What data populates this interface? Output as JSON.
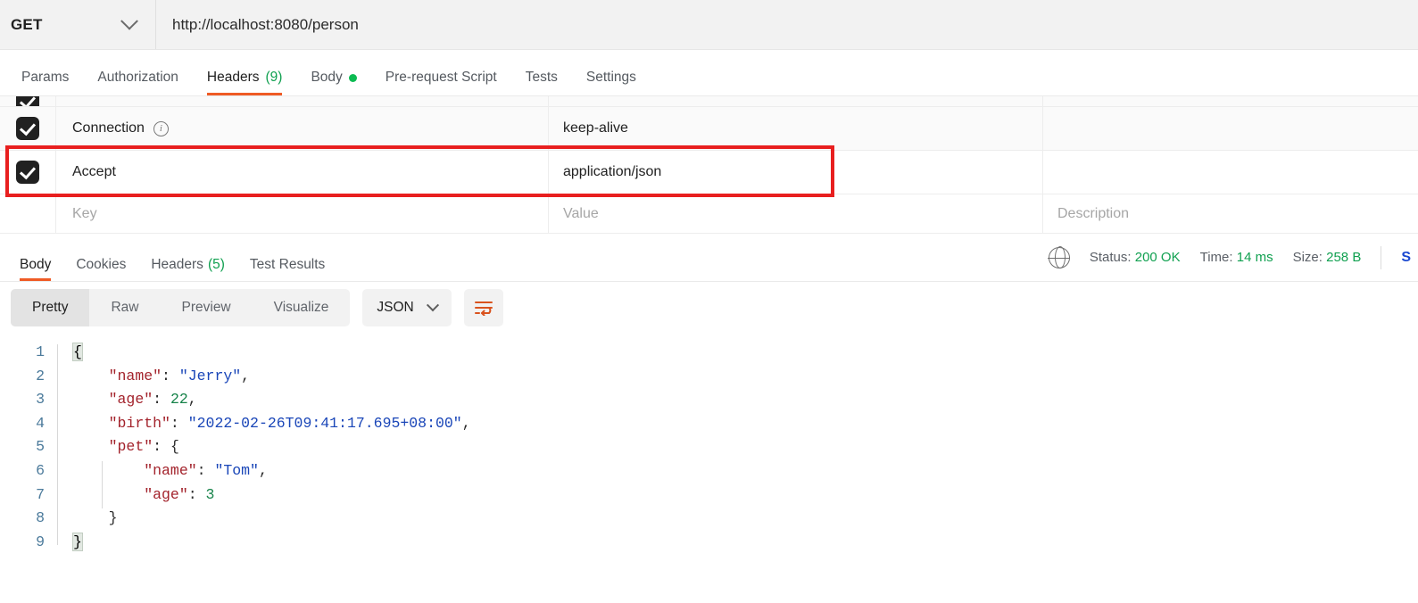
{
  "request_bar": {
    "method": "GET",
    "method_caret_icon": "chevron-down-icon",
    "url": "http://localhost:8080/person"
  },
  "request_tabs": [
    {
      "label": "Params",
      "active": false
    },
    {
      "label": "Authorization",
      "active": false
    },
    {
      "label": "Headers",
      "count": "(9)",
      "active": true
    },
    {
      "label": "Body",
      "dot": true,
      "active": false
    },
    {
      "label": "Pre-request Script",
      "active": false
    },
    {
      "label": "Tests",
      "active": false
    },
    {
      "label": "Settings",
      "active": false
    }
  ],
  "headers_table": {
    "columns": {
      "key": "Key",
      "value": "Value",
      "description": "Description"
    },
    "rows": [
      {
        "checked": true,
        "key": "Connection",
        "info": true,
        "value": "keep-alive",
        "description": ""
      },
      {
        "checked": true,
        "key": "Accept",
        "info": false,
        "value": "application/json",
        "description": "",
        "highlighted": true
      }
    ],
    "placeholder_row": {
      "key": "Key",
      "value": "Value",
      "description": "Description"
    },
    "highlight_color": "#e81f1f"
  },
  "response_tabs": [
    {
      "label": "Body",
      "active": true
    },
    {
      "label": "Cookies",
      "active": false
    },
    {
      "label": "Headers",
      "count": "(5)",
      "active": false
    },
    {
      "label": "Test Results",
      "active": false
    }
  ],
  "response_status": {
    "globe_icon": "globe-icon",
    "status_label": "Status:",
    "status_value": "200 OK",
    "time_label": "Time:",
    "time_value": "14 ms",
    "size_label": "Size:",
    "size_value": "258 B",
    "save_link": "S",
    "value_color": "#10a050"
  },
  "format_toolbar": {
    "views": [
      {
        "label": "Pretty",
        "active": true
      },
      {
        "label": "Raw",
        "active": false
      },
      {
        "label": "Preview",
        "active": false
      },
      {
        "label": "Visualize",
        "active": false
      }
    ],
    "language": "JSON",
    "language_caret_icon": "chevron-down-icon",
    "wrap_button_icon": "word-wrap-icon"
  },
  "response_body": {
    "line_numbers": [
      "1",
      "2",
      "3",
      "4",
      "5",
      "6",
      "7",
      "8",
      "9"
    ],
    "lines": [
      [
        {
          "t": "{",
          "c": "brace-hl"
        }
      ],
      [
        {
          "t": "    ",
          "c": "p"
        },
        {
          "t": "\"name\"",
          "c": "k"
        },
        {
          "t": ": ",
          "c": "p"
        },
        {
          "t": "\"Jerry\"",
          "c": "s"
        },
        {
          "t": ",",
          "c": "p"
        }
      ],
      [
        {
          "t": "    ",
          "c": "p"
        },
        {
          "t": "\"age\"",
          "c": "k"
        },
        {
          "t": ": ",
          "c": "p"
        },
        {
          "t": "22",
          "c": "n"
        },
        {
          "t": ",",
          "c": "p"
        }
      ],
      [
        {
          "t": "    ",
          "c": "p"
        },
        {
          "t": "\"birth\"",
          "c": "k"
        },
        {
          "t": ": ",
          "c": "p"
        },
        {
          "t": "\"2022-02-26T09:41:17.695+08:00\"",
          "c": "s"
        },
        {
          "t": ",",
          "c": "p"
        }
      ],
      [
        {
          "t": "    ",
          "c": "p"
        },
        {
          "t": "\"pet\"",
          "c": "k"
        },
        {
          "t": ": ",
          "c": "p"
        },
        {
          "t": "{",
          "c": "p"
        }
      ],
      [
        {
          "t": "        ",
          "c": "p"
        },
        {
          "t": "\"name\"",
          "c": "k"
        },
        {
          "t": ": ",
          "c": "p"
        },
        {
          "t": "\"Tom\"",
          "c": "s"
        },
        {
          "t": ",",
          "c": "p"
        }
      ],
      [
        {
          "t": "        ",
          "c": "p"
        },
        {
          "t": "\"age\"",
          "c": "k"
        },
        {
          "t": ": ",
          "c": "p"
        },
        {
          "t": "3",
          "c": "n"
        }
      ],
      [
        {
          "t": "    ",
          "c": "p"
        },
        {
          "t": "}",
          "c": "p"
        }
      ],
      [
        {
          "t": "}",
          "c": "brace-hl"
        }
      ]
    ]
  }
}
